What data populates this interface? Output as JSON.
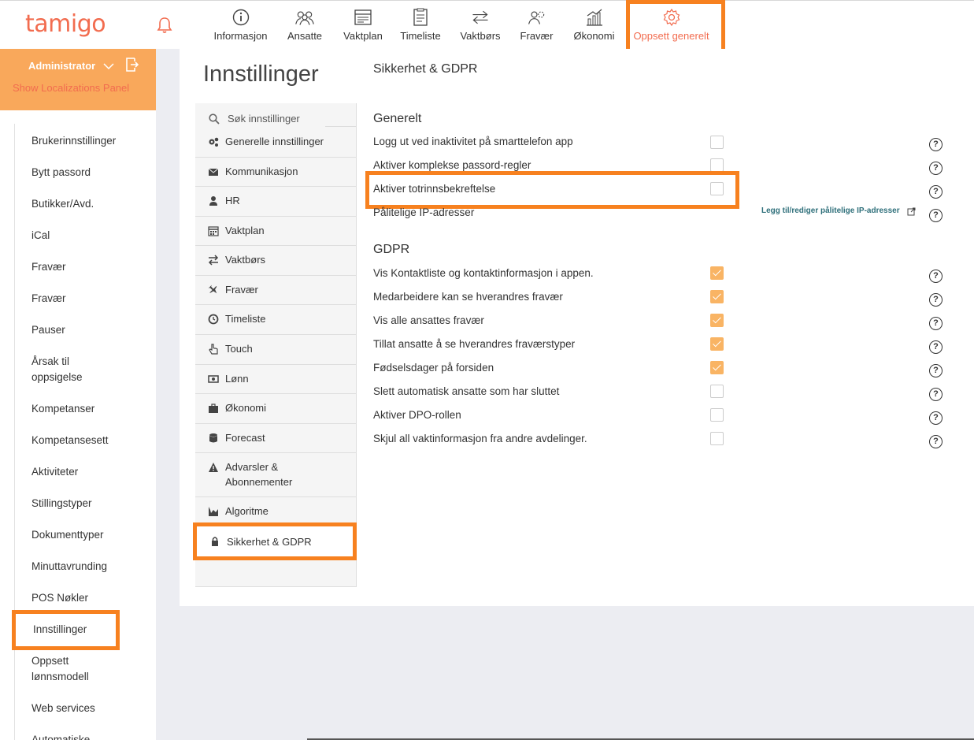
{
  "brand": {
    "logo": "tamigo"
  },
  "topnav": {
    "items": [
      {
        "label": "Informasjon",
        "icon": "info-icon"
      },
      {
        "label": "Ansatte",
        "icon": "people-icon"
      },
      {
        "label": "Vaktplan",
        "icon": "calendar-icon"
      },
      {
        "label": "Timeliste",
        "icon": "timesheet-icon"
      },
      {
        "label": "Vaktbørs",
        "icon": "swap-icon"
      },
      {
        "label": "Fravær",
        "icon": "absence-icon"
      },
      {
        "label": "Økonomi",
        "icon": "economy-icon"
      },
      {
        "label": "Oppsett generelt",
        "icon": "gear-icon",
        "active": true
      }
    ]
  },
  "admin": {
    "role": "Administrator",
    "link": "Show Localizations Panel"
  },
  "leftnav": {
    "items": [
      "Brukerinnstillinger",
      "Bytt passord",
      "Butikker/Avd.",
      "iCal",
      "Fravær",
      "Fravær",
      "Pauser",
      "Årsak til oppsigelse",
      "Kompetanser",
      "Kompetansesett",
      "Aktiviteter",
      "Stillingstyper",
      "Dokumenttyper",
      "Minuttavrunding",
      "POS Nøkler",
      "Innstillinger",
      "Oppsett lønnsmodell",
      "Web services",
      "Automatiske"
    ],
    "active": "Innstillinger"
  },
  "page": {
    "title": "Innstillinger"
  },
  "settings_nav": {
    "search_placeholder": "Søk innstillinger",
    "items": [
      "Generelle innstillinger",
      "Kommunikasjon",
      "HR",
      "Vaktplan",
      "Vaktbørs",
      "Fravær",
      "Timeliste",
      "Touch",
      "Lønn",
      "Økonomi",
      "Forecast",
      "Advarsler & Abonnementer",
      "Algoritme",
      "Sikkerhet & GDPR"
    ],
    "active": "Sikkerhet & GDPR"
  },
  "section": {
    "title": "Sikkerhet & GDPR",
    "general": {
      "title": "Generelt",
      "rows": [
        {
          "label": "Logg ut ved inaktivitet på smarttelefon app",
          "checked": false
        },
        {
          "label": "Aktiver komplekse passord-regler",
          "checked": false
        },
        {
          "label": "Aktiver totrinnsbekreftelse",
          "checked": false
        },
        {
          "label": "Pålitelige IP-adresser",
          "link": "Legg til/rediger pålitelige IP-adresser"
        }
      ]
    },
    "gdpr": {
      "title": "GDPR",
      "rows": [
        {
          "label": "Vis Kontaktliste og kontaktinformasjon i appen.",
          "checked": true
        },
        {
          "label": "Medarbeidere kan se hverandres fravær",
          "checked": true
        },
        {
          "label": "Vis alle ansattes fravær",
          "checked": true
        },
        {
          "label": "Tillat ansatte å se hverandres fraværstyper",
          "checked": true
        },
        {
          "label": "Fødselsdager på forsiden",
          "checked": true
        },
        {
          "label": "Slett automatisk ansatte som har sluttet",
          "checked": false
        },
        {
          "label": "Aktiver DPO-rollen",
          "checked": false
        },
        {
          "label": "Skjul all vaktinformasjon fra andre avdelinger.",
          "checked": false
        }
      ]
    }
  },
  "help_glyph": "?",
  "colors": {
    "brand": "#f26c4f",
    "admin_bg": "#f9a85b",
    "highlight": "#f7811f",
    "checked": "#f9b464",
    "link": "#2e6f7a"
  }
}
